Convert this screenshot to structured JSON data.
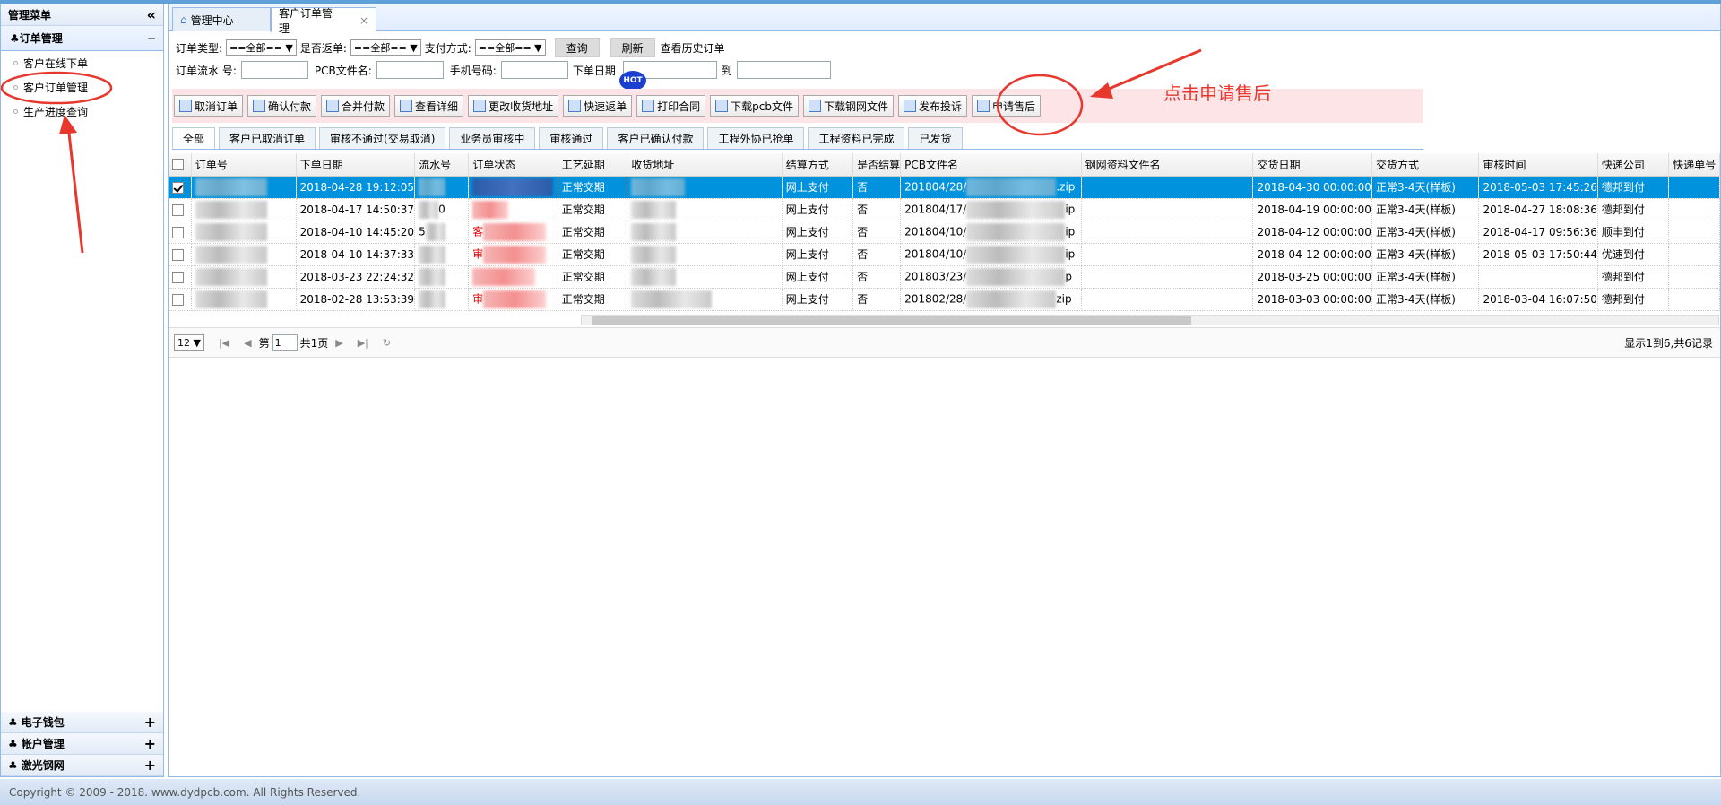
{
  "sidebar": {
    "title": "管理菜单",
    "collapse_icon": "«",
    "group": {
      "title": "订单管理",
      "toggle": "−",
      "items": [
        {
          "label": "客户在线下单"
        },
        {
          "label": "客户订单管理"
        },
        {
          "label": "生产进度查询"
        }
      ]
    },
    "bottom": [
      {
        "label": "电子钱包",
        "toggle": "+"
      },
      {
        "label": "帐户管理",
        "toggle": "+"
      },
      {
        "label": "激光钢网",
        "toggle": "+"
      }
    ]
  },
  "tabs": [
    {
      "label": "管理中心"
    },
    {
      "label": "客户订单管理",
      "close": "×"
    }
  ],
  "filters": {
    "order_type_label": "订单类型:",
    "order_type_value": "==全部== ▼",
    "return_label": "是否返单:",
    "return_value": "==全部== ▼",
    "pay_label": "支付方式:",
    "pay_value": "==全部== ▼",
    "query_btn": "查询",
    "refresh_btn": "刷新",
    "history_link": "查看历史订单",
    "serial_label": "订单流水 号:",
    "pcb_label": "PCB文件名:",
    "phone_label": "手机号码:",
    "date_label": "下单日期",
    "to_label": "到",
    "hot_badge": "HOT"
  },
  "toolbar": [
    "取消订单",
    "确认付款",
    "合并付款",
    "查看详细",
    "更改收货地址",
    "快速返单",
    "打印合同",
    "下载pcb文件",
    "下载钢网文件",
    "发布投诉",
    "申请售后"
  ],
  "filter_tabs": [
    "全部",
    "客户已取消订单",
    "审核不通过(交易取消)",
    "业务员审核中",
    "审核通过",
    "客户已确认付款",
    "工程外协已抢单",
    "工程资料已完成",
    "已发货"
  ],
  "grid": {
    "columns": [
      "订单号",
      "下单日期",
      "流水号",
      "订单状态",
      "工艺延期",
      "收货地址",
      "结算方式",
      "是否结算",
      "PCB文件名",
      "钢网资料文件名",
      "交货日期",
      "交货方式",
      "审核时间",
      "快递公司",
      "快递单号"
    ],
    "rows": [
      {
        "date": "2018-04-28 19:12:05",
        "craft": "正常交期",
        "pay": "网上支付",
        "settled": "否",
        "pcb_pre": "201804/28/",
        "pcb_suf": ".zip",
        "delivery": "2018-04-30 00:00:00",
        "method": "正常3-4天(样板)",
        "audit": "2018-05-03 17:45:26",
        "express": "德邦到付"
      },
      {
        "date": "2018-04-17 14:50:37",
        "serial_tail": "0",
        "craft": "正常交期",
        "pay": "网上支付",
        "settled": "否",
        "pcb_pre": "201804/17/",
        "pcb_suf": "ip",
        "delivery": "2018-04-19 00:00:00",
        "method": "正常3-4天(样板)",
        "audit": "2018-04-27 18:08:36",
        "express": "德邦到付"
      },
      {
        "date": "2018-04-10 14:45:20",
        "serial_head": "5",
        "status_head": "客",
        "craft": "正常交期",
        "pay": "网上支付",
        "settled": "否",
        "pcb_pre": "201804/10/",
        "pcb_suf": "ip",
        "delivery": "2018-04-12 00:00:00",
        "method": "正常3-4天(样板)",
        "audit": "2018-04-17 09:56:36",
        "express": "顺丰到付"
      },
      {
        "date": "2018-04-10 14:37:33",
        "status_head": "审",
        "craft": "正常交期",
        "pay": "网上支付",
        "settled": "否",
        "pcb_pre": "201804/10/",
        "pcb_suf": "ip",
        "delivery": "2018-04-12 00:00:00",
        "method": "正常3-4天(样板)",
        "audit": "2018-05-03 17:50:44",
        "express": "优速到付"
      },
      {
        "date": "2018-03-23 22:24:32",
        "craft": "正常交期",
        "pay": "网上支付",
        "settled": "否",
        "pcb_pre": "201803/23/",
        "pcb_suf": "p",
        "delivery": "2018-03-25 00:00:00",
        "method": "正常3-4天(样板)",
        "audit": "",
        "express": "德邦到付"
      },
      {
        "date": "2018-02-28 13:53:39",
        "status_head": "审",
        "craft": "正常交期",
        "pay": "网上支付",
        "settled": "否",
        "pcb_pre": "201802/28/",
        "pcb_suf": "zip",
        "delivery": "2018-03-03 00:00:00",
        "method": "正常3-4天(样板)",
        "audit": "2018-03-04 16:07:50",
        "express": "德邦到付"
      }
    ]
  },
  "pager": {
    "page_size": "12 ▼",
    "page_prefix": "第",
    "page_value": "1",
    "page_suffix": "共1页",
    "summary": "显示1到6,共6记录"
  },
  "annotation": {
    "text": "点击申请售后"
  },
  "footer": {
    "text": "Copyright © 2009 - 2018. www.dydpcb.com. All Rights Reserved."
  },
  "colors": {
    "selected_row": "#0092dc",
    "annotation_red": "#e8372c",
    "toolbar_bg": "#fce4e7"
  }
}
